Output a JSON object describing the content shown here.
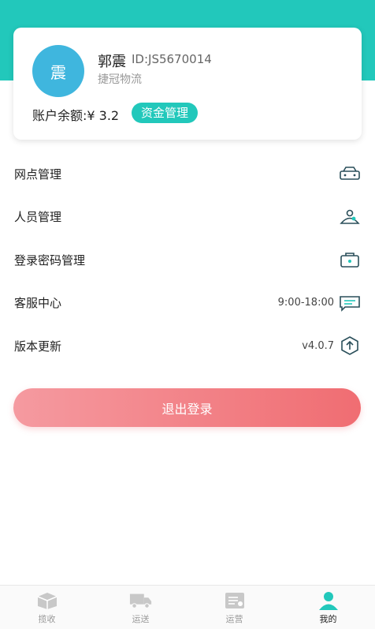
{
  "profile": {
    "avatar_text": "震",
    "name": "郭震",
    "id_text": "ID:JS5670014",
    "company": "捷冠物流",
    "balance_text": "账户余额:¥ 3.2",
    "fund_button": "资金管理"
  },
  "menu": {
    "outlets": {
      "label": "网点管理"
    },
    "staff": {
      "label": "人员管理"
    },
    "password": {
      "label": "登录密码管理"
    },
    "service": {
      "label": "客服中心",
      "value": "9:00-18:00"
    },
    "version": {
      "label": "版本更新",
      "value": "v4.0.7"
    }
  },
  "logout": {
    "label": "退出登录"
  },
  "tabbar": {
    "tabs": [
      {
        "label": "揽收"
      },
      {
        "label": "运送"
      },
      {
        "label": "运营"
      },
      {
        "label": "我的"
      }
    ],
    "active_index": 3
  },
  "colors": {
    "accent": "#22c8bb",
    "avatar": "#3fb6de",
    "logout_start": "#f59aa0",
    "logout_end": "#f06d72"
  }
}
